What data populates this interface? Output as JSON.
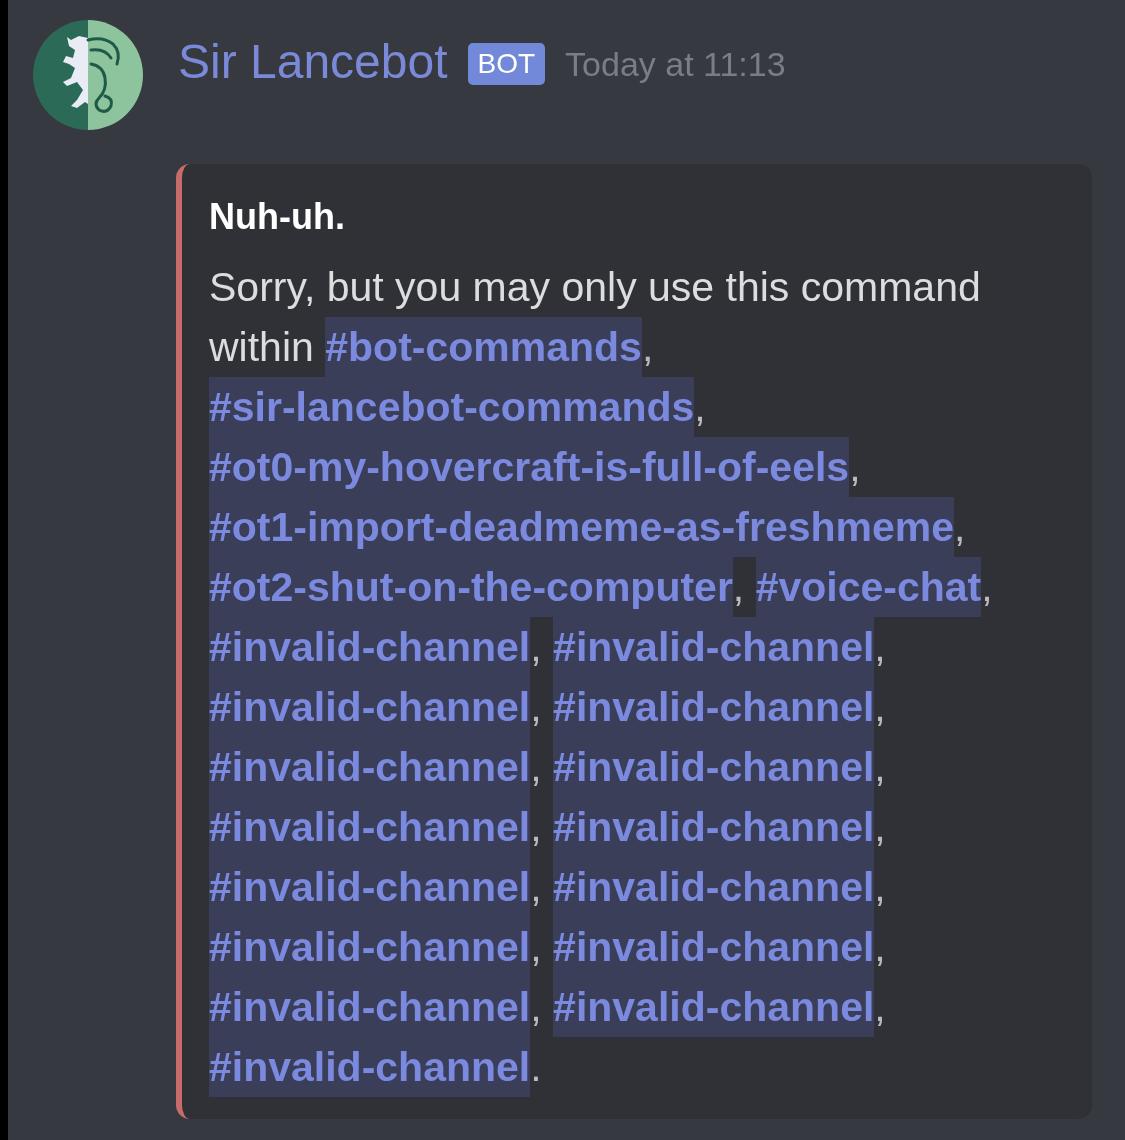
{
  "message": {
    "author": "Sir Lancebot",
    "badge": "BOT",
    "timestamp": "Today at 11:13",
    "embed": {
      "color": "#c76b6b",
      "title": "Nuh-uh.",
      "intro": "Sorry, but you may only use this command within",
      "channels": [
        {
          "name": "#bot-commands",
          "after": ","
        },
        {
          "name": "#sir-lancebot-commands",
          "after": ","
        },
        {
          "name": "#ot0-my-hovercraft-is-full-of-eels",
          "after": ","
        },
        {
          "name": "#ot1-import-deadmeme-as-freshmeme",
          "after": ","
        },
        {
          "name": "#ot2-shut-on-the-computer",
          "after": ","
        },
        {
          "name": "#voice-chat",
          "after": ","
        },
        {
          "name": "#invalid-channel",
          "after": ","
        },
        {
          "name": "#invalid-channel",
          "after": ","
        },
        {
          "name": "#invalid-channel",
          "after": ","
        },
        {
          "name": "#invalid-channel",
          "after": ","
        },
        {
          "name": "#invalid-channel",
          "after": ","
        },
        {
          "name": "#invalid-channel",
          "after": ","
        },
        {
          "name": "#invalid-channel",
          "after": ","
        },
        {
          "name": "#invalid-channel",
          "after": ","
        },
        {
          "name": "#invalid-channel",
          "after": ","
        },
        {
          "name": "#invalid-channel",
          "after": ","
        },
        {
          "name": "#invalid-channel",
          "after": ","
        },
        {
          "name": "#invalid-channel",
          "after": ","
        },
        {
          "name": "#invalid-channel",
          "after": ","
        },
        {
          "name": "#invalid-channel",
          "after": ","
        },
        {
          "name": "#invalid-channel",
          "after": "."
        }
      ]
    }
  }
}
